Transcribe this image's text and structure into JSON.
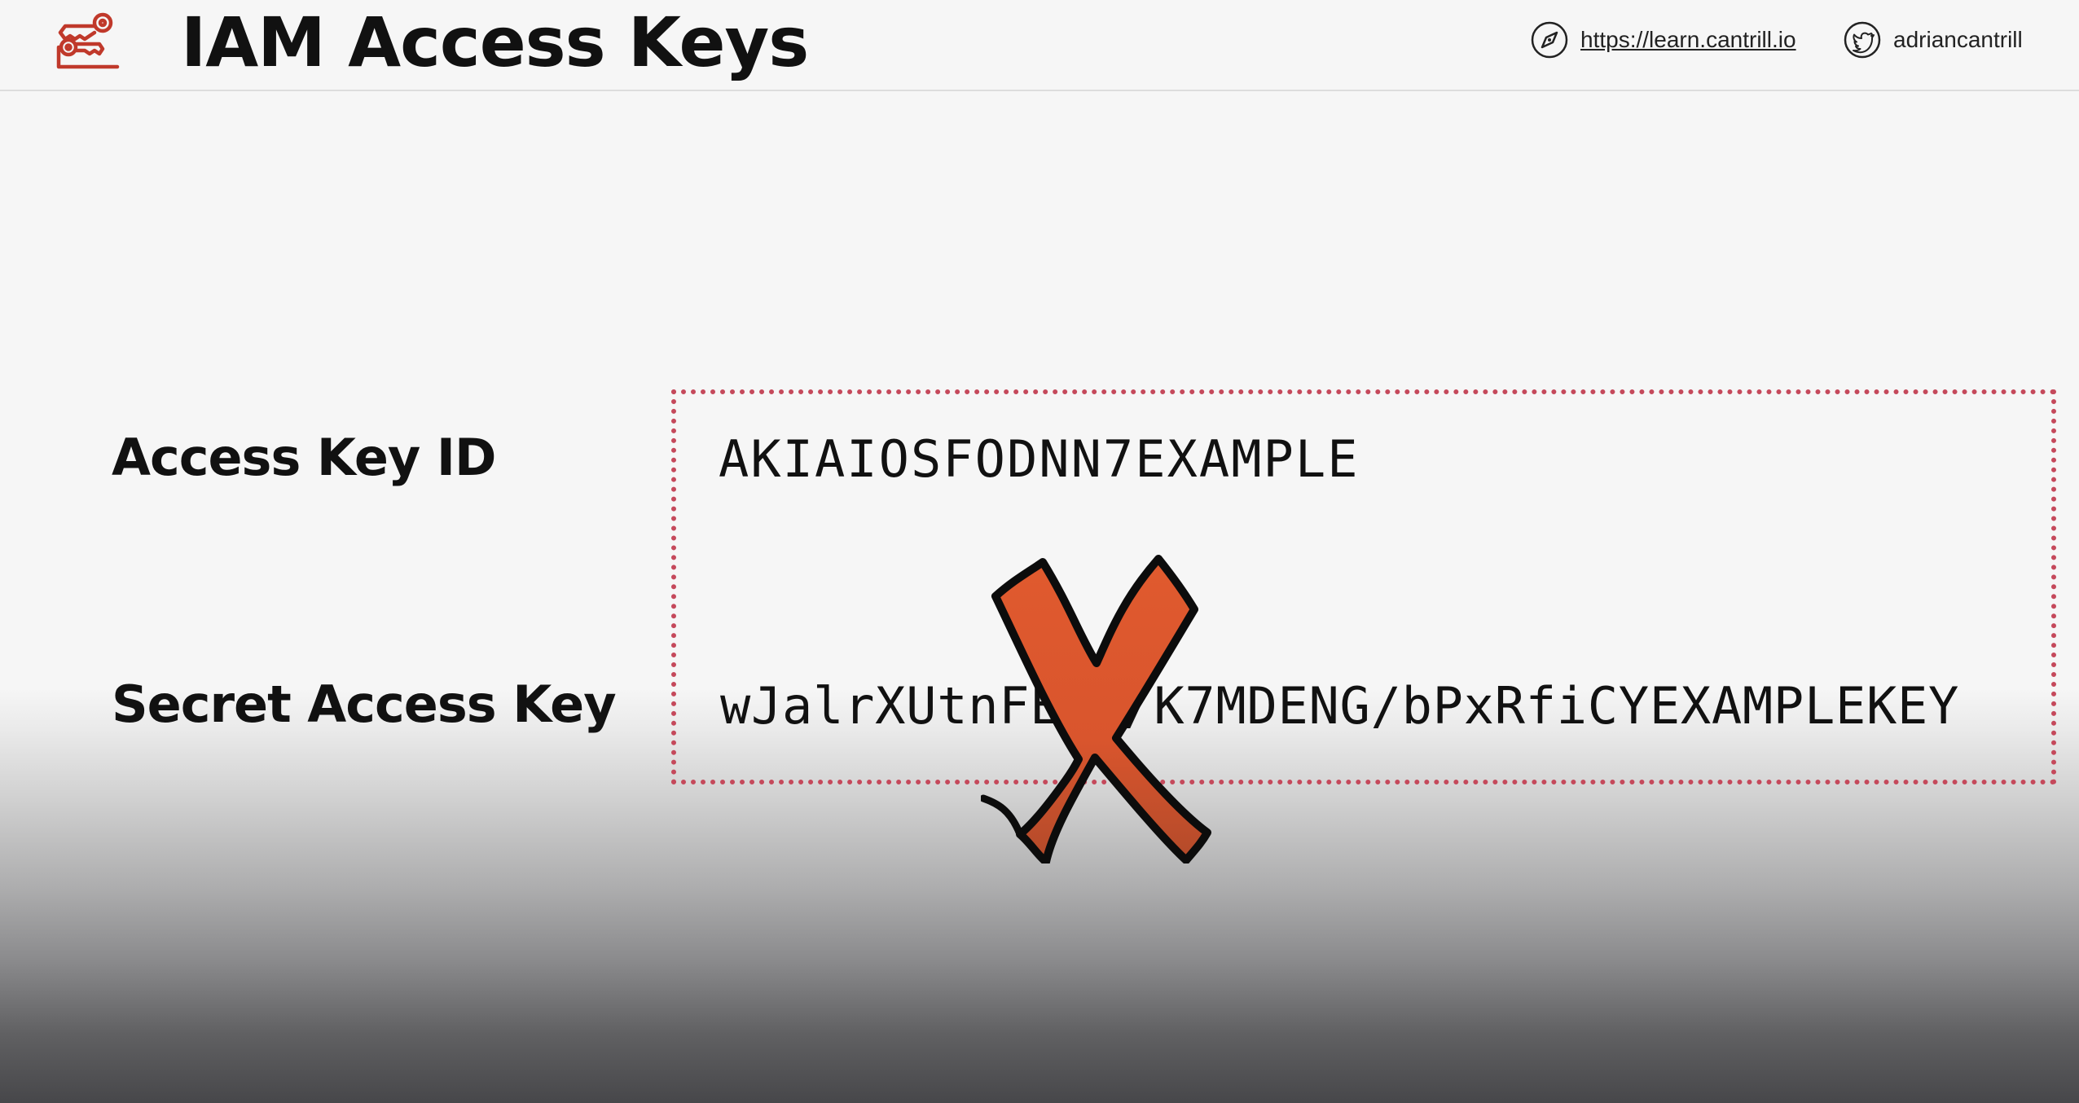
{
  "header": {
    "title": "IAM Access Keys",
    "logo_icon": "keys-icon",
    "logo_color": "#c0392b",
    "site_link": "https://learn.cantrill.io",
    "site_icon": "compass-icon",
    "twitter_handle": "adriancantrill",
    "twitter_icon": "twitter-icon"
  },
  "credentials": {
    "access_key_id_label": "Access Key ID",
    "access_key_id_value": "AKIAIOSFODNN7EXAMPLE",
    "secret_access_key_label": "Secret Access Key",
    "secret_access_key_value": "wJalrXUtnFEMI/K7MDENG/bPxRfiCYEXAMPLEKEY",
    "box_border_color": "#c5495b"
  },
  "overlay": {
    "icon": "cross-mark-icon",
    "fill_color": "#e05a2e"
  }
}
